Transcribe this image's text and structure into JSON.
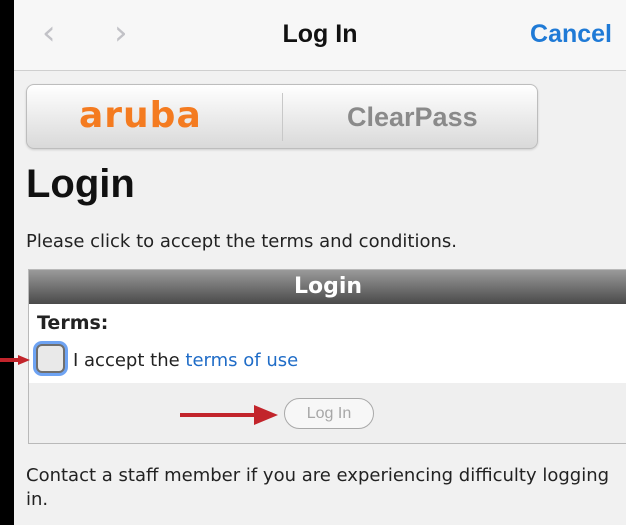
{
  "nav": {
    "back_icon": "chevron-left-icon",
    "forward_icon": "chevron-right-icon",
    "title": "Log In",
    "cancel_label": "Cancel",
    "accent_color": "#1f7ad6"
  },
  "banner": {
    "logo_text": "aruba",
    "product_text": "ClearPass",
    "logo_color": "#f47b20"
  },
  "page": {
    "title": "Login",
    "intro": "Please click to accept the terms and conditions."
  },
  "login_box": {
    "header": "Login",
    "terms_heading": "Terms:",
    "accept_prefix": "I accept the",
    "terms_link": "terms of use",
    "checkbox_checked": false,
    "login_button": "Log In",
    "login_button_enabled": false
  },
  "footer": {
    "text": "Contact a staff member if you are experiencing difficulty logging in."
  },
  "annotations": {
    "arrow_color": "#c2242b",
    "arrow_icons": [
      "arrow-right-icon",
      "arrow-right-icon"
    ]
  }
}
